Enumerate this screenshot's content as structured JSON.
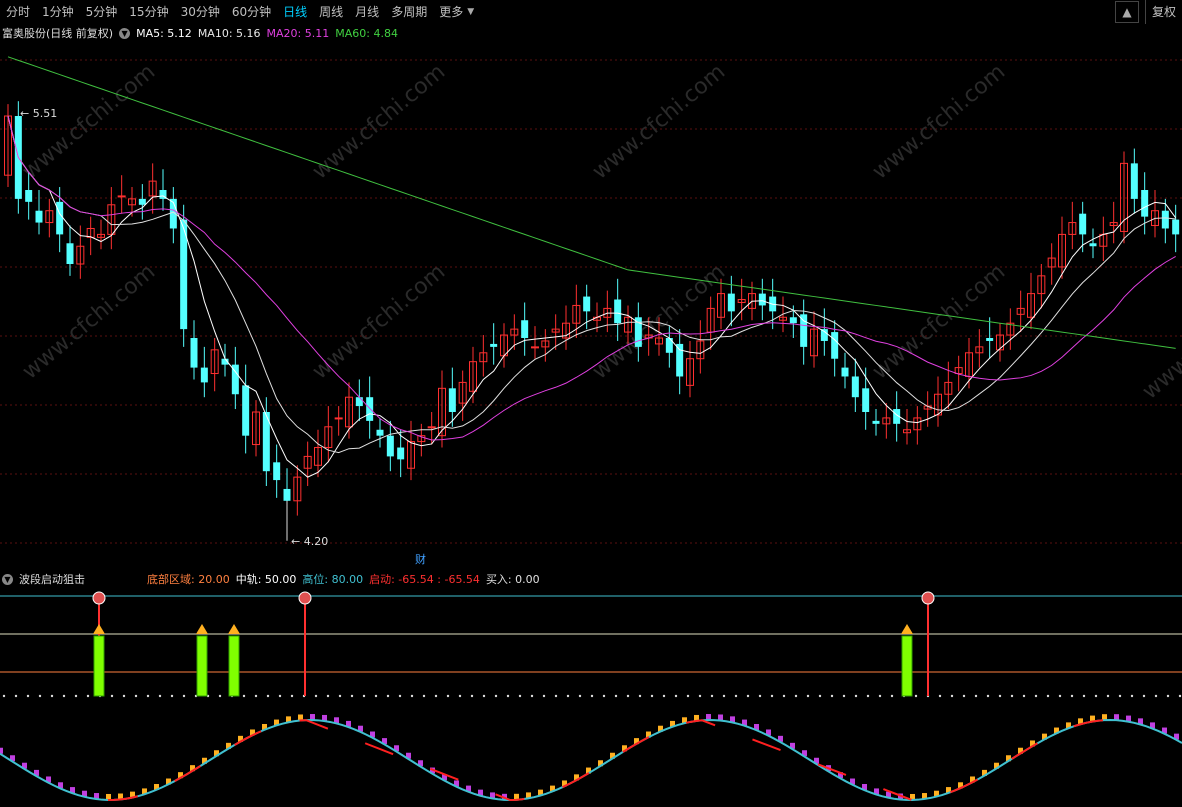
{
  "toolbar": {
    "periods": [
      "分时",
      "1分钟",
      "5分钟",
      "15分钟",
      "30分钟",
      "60分钟",
      "日线",
      "周线",
      "月线",
      "多周期",
      "更多"
    ],
    "active": "日线",
    "fuquan": "复权"
  },
  "main": {
    "title": "富奥股份(日线 前复权)",
    "ma5": "MA5: 5.12",
    "ma10": "MA10: 5.16",
    "ma20": "MA20: 5.11",
    "ma60": "MA60: 4.84",
    "high_label": "5.51",
    "low_label": "4.20",
    "event_label": "财",
    "watermark": "www.cfchi.com"
  },
  "indicator": {
    "name": "波段启动狙击",
    "bottom": "底部区域: 20.00",
    "mid": "中轨: 50.00",
    "high": "高位: 80.00",
    "start": "启动: -65.54 : -65.54",
    "buy": "买入: 0.00"
  },
  "colors": {
    "up": "#ff3030",
    "down": "#54ffff",
    "ma5": "#ffffff",
    "ma10": "#e0e0e0",
    "ma20": "#e040e0",
    "ma60": "#40c040",
    "grid": "#5a1010"
  },
  "chart_data": {
    "type": "candlestick",
    "ylim": [
      4.0,
      5.75
    ],
    "high_value": 5.51,
    "low_value": 4.2,
    "closes": [
      5.5,
      5.22,
      5.21,
      5.14,
      5.18,
      5.1,
      5.0,
      5.06,
      5.12,
      5.1,
      5.2,
      5.23,
      5.22,
      5.2,
      5.28,
      5.22,
      5.12,
      4.78,
      4.65,
      4.6,
      4.71,
      4.66,
      4.56,
      4.42,
      4.5,
      4.3,
      4.27,
      4.2,
      4.28,
      4.35,
      4.38,
      4.45,
      4.48,
      4.55,
      4.52,
      4.47,
      4.42,
      4.35,
      4.34,
      4.4,
      4.42,
      4.45,
      4.58,
      4.5,
      4.6,
      4.67,
      4.7,
      4.72,
      4.76,
      4.78,
      4.75,
      4.72,
      4.74,
      4.78,
      4.8,
      4.86,
      4.84,
      4.82,
      4.85,
      4.8,
      4.82,
      4.72,
      4.76,
      4.75,
      4.7,
      4.62,
      4.68,
      4.74,
      4.85,
      4.9,
      4.84,
      4.88,
      4.9,
      4.86,
      4.84,
      4.82,
      4.8,
      4.72,
      4.78,
      4.74,
      4.68,
      4.62,
      4.55,
      4.5,
      4.46,
      4.48,
      4.46,
      4.44,
      4.48,
      4.52,
      4.56,
      4.6,
      4.65,
      4.7,
      4.72,
      4.74,
      4.76,
      4.8,
      4.85,
      4.9,
      4.96,
      5.02,
      5.1,
      5.14,
      5.1,
      5.06,
      5.1,
      5.14,
      5.34,
      5.22,
      5.16,
      5.18,
      5.12,
      5.1
    ]
  }
}
